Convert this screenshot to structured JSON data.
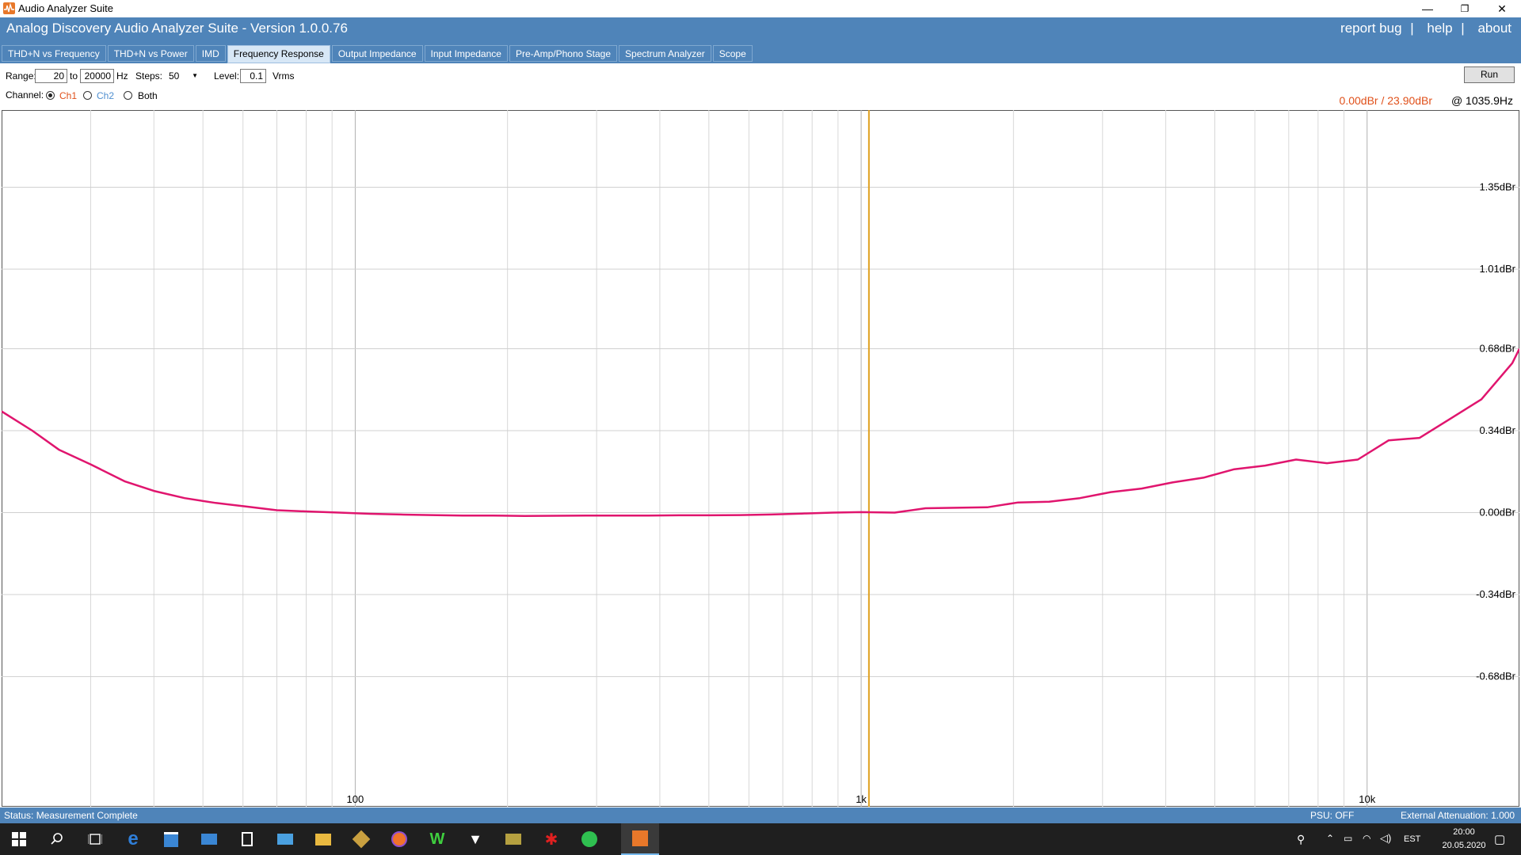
{
  "window": {
    "title": "Audio Analyzer Suite",
    "min": "—",
    "max": "❐",
    "close": "✕"
  },
  "header": {
    "title": "Analog Discovery Audio Analyzer Suite - Version   1.0.0.76",
    "links": [
      "report bug",
      "help",
      "about"
    ]
  },
  "tabs": [
    {
      "label": "THD+N vs Frequency"
    },
    {
      "label": "THD+N vs Power"
    },
    {
      "label": "IMD"
    },
    {
      "label": "Frequency Response",
      "active": true
    },
    {
      "label": "Output Impedance"
    },
    {
      "label": "Input Impedance"
    },
    {
      "label": "Pre-Amp/Phono Stage"
    },
    {
      "label": "Spectrum Analyzer"
    },
    {
      "label": "Scope"
    }
  ],
  "controls": {
    "range_label": "Range:",
    "range_from": "20",
    "to_label": "to",
    "range_to": "20000",
    "hz_label": "Hz",
    "steps_label": "Steps:",
    "steps_value": "50",
    "level_label": "Level:",
    "level_value": "0.1",
    "vrms_label": "Vrms",
    "run_label": "Run",
    "channel_label": "Channel:",
    "channels": [
      {
        "label": "Ch1",
        "selected": true,
        "color": "#e0501a"
      },
      {
        "label": "Ch2",
        "selected": false,
        "color": "#4f8fd0"
      },
      {
        "label": "Both",
        "selected": false,
        "color": "#000000"
      }
    ]
  },
  "readout": {
    "value": "0.00dBr / 23.90dBr",
    "freq": "@ 1035.9Hz"
  },
  "colors": {
    "trace": "#e0156e",
    "cursor": "#e0a020",
    "header": "#4f84b9",
    "readout": "#e0501a"
  },
  "chart_data": {
    "type": "line",
    "x_scale": "log",
    "xlim": [
      20,
      20000
    ],
    "ylim": [
      -1.22,
      1.67
    ],
    "x_ticks": [
      {
        "value": 100,
        "label": "100"
      },
      {
        "value": 1000,
        "label": "1k"
      },
      {
        "value": 10000,
        "label": "10k"
      }
    ],
    "y_ticks": [
      {
        "value": 1.35,
        "label": "1.35dBr"
      },
      {
        "value": 1.01,
        "label": "1.01dBr"
      },
      {
        "value": 0.68,
        "label": "0.68dBr"
      },
      {
        "value": 0.34,
        "label": "0.34dBr"
      },
      {
        "value": 0.0,
        "label": "0.00dBr"
      },
      {
        "value": -0.34,
        "label": "-0.34dBr"
      },
      {
        "value": -0.68,
        "label": "-0.68dBr"
      }
    ],
    "grid": true,
    "cursor_x": 1035.9,
    "series": [
      {
        "x": [
          20,
          23,
          26,
          30,
          35,
          40,
          46,
          53,
          61,
          70,
          80,
          93,
          107,
          123,
          141,
          163,
          187,
          216,
          248,
          286,
          329,
          379,
          436,
          501,
          577,
          664,
          764,
          879,
          1000,
          1165,
          1340,
          1543,
          1775,
          2043,
          2352,
          2706,
          3115,
          3585,
          4125,
          4748,
          5464,
          6289,
          7238,
          8330,
          9587,
          11034,
          12699,
          14615,
          16821,
          19360,
          20000
        ],
        "values": [
          0.42,
          0.34,
          0.26,
          0.2,
          0.13,
          0.09,
          0.06,
          0.04,
          0.025,
          0.01,
          0.005,
          0.0,
          -0.005,
          -0.008,
          -0.01,
          -0.012,
          -0.012,
          -0.014,
          -0.013,
          -0.012,
          -0.012,
          -0.012,
          -0.011,
          -0.011,
          -0.01,
          -0.008,
          -0.004,
          0.0,
          0.002,
          0.0,
          0.018,
          0.02,
          0.022,
          0.042,
          0.045,
          0.06,
          0.085,
          0.1,
          0.125,
          0.145,
          0.18,
          0.195,
          0.22,
          0.205,
          0.22,
          0.3,
          0.31,
          0.39,
          0.47,
          0.62,
          0.68
        ]
      }
    ]
  },
  "status": {
    "left": "Status: Measurement Complete",
    "psu": "PSU: OFF",
    "attenuation": "External Attenuation: 1.000"
  },
  "taskbar": {
    "lang": "EST",
    "time": "20:00",
    "date": "20.05.2020",
    "apps": [
      "start-icon",
      "search-icon",
      "task-view-icon",
      "edge-icon",
      "store-icon",
      "mail-icon",
      "calculator-icon",
      "photos-icon",
      "file-explorer-icon",
      "cleaner-icon",
      "firefox-icon",
      "winamp-icon",
      "wolf-icon",
      "money-icon",
      "game-icon",
      "whatsapp-icon",
      "audio-analyzer-icon"
    ]
  }
}
